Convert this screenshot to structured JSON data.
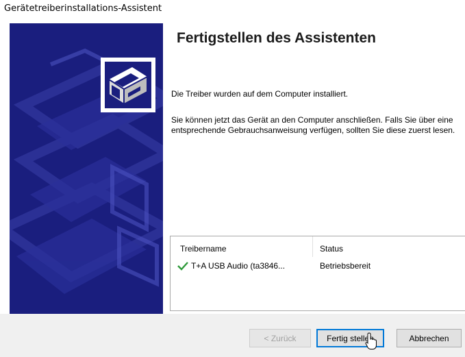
{
  "window": {
    "title": "Gerätetreiberinstallations-Assistent"
  },
  "main": {
    "heading": "Fertigstellen des Assistenten",
    "paragraph1": "Die Treiber wurden auf dem Computer installiert.",
    "paragraph2": "Sie können jetzt das Gerät an den Computer anschließen. Falls Sie über eine entsprechende Gebrauchsanweisung verfügen, sollten Sie diese zuerst lesen."
  },
  "drivers": {
    "columns": [
      "Treibername",
      "Status"
    ],
    "rows": [
      {
        "name": "T+A USB Audio (ta3846...",
        "status": "Betriebsbereit",
        "icon": "green-check-icon"
      }
    ]
  },
  "buttons": {
    "back": "< Zurück",
    "finish": "Fertig stellen",
    "cancel": "Abbrechen"
  },
  "colors": {
    "side_panel": "#1a1e7e",
    "check": "#2e9a3a",
    "default_button_border": "#0078d7"
  }
}
